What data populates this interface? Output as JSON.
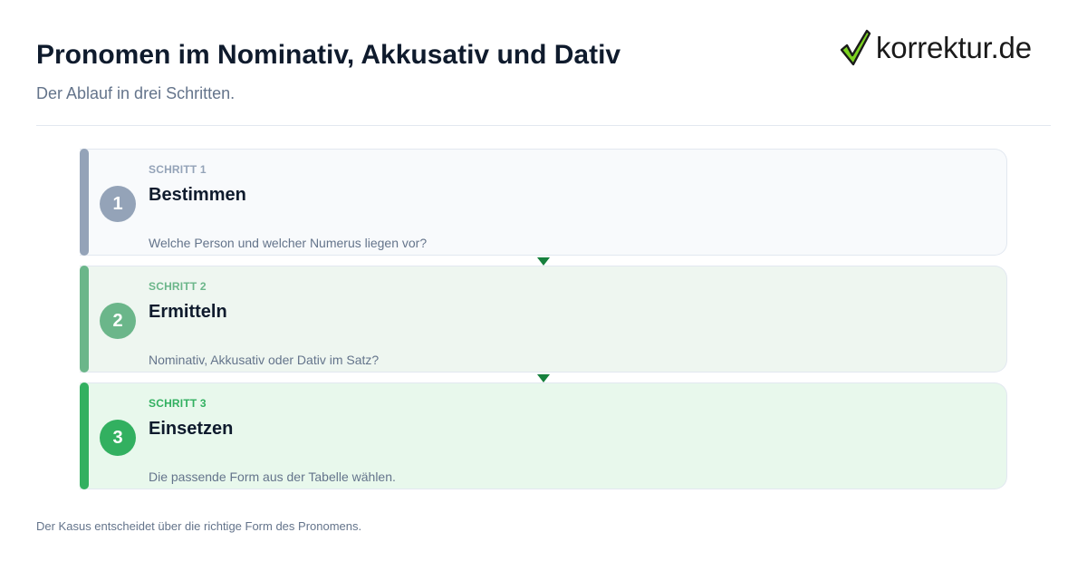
{
  "header": {
    "title": "Pronomen im Nominativ, Akkusativ und Dativ",
    "subtitle": "Der Ablauf in drei Schritten."
  },
  "logo": {
    "text": "korrektur.de",
    "icon": "check-icon",
    "icon_colors": [
      "#7cd321",
      "#1a1a1a"
    ]
  },
  "steps": [
    {
      "number": "1",
      "kicker": "SCHRITT 1",
      "title": "Bestimmen",
      "description": "Welche Person und welcher Numerus liegen vor?",
      "accent": "#94a3b8"
    },
    {
      "number": "2",
      "kicker": "SCHRITT 2",
      "title": "Ermitteln",
      "description": "Nominativ, Akkusativ oder Dativ im Satz?",
      "accent": "#6bb68a"
    },
    {
      "number": "3",
      "kicker": "SCHRITT 3",
      "title": "Einsetzen",
      "description": "Die passende Form aus der Tabelle wählen.",
      "accent": "#32b060"
    }
  ],
  "connector_color": "#16803d",
  "footer": {
    "note": "Der Kasus entscheidet über die richtige Form des Pronomens."
  }
}
